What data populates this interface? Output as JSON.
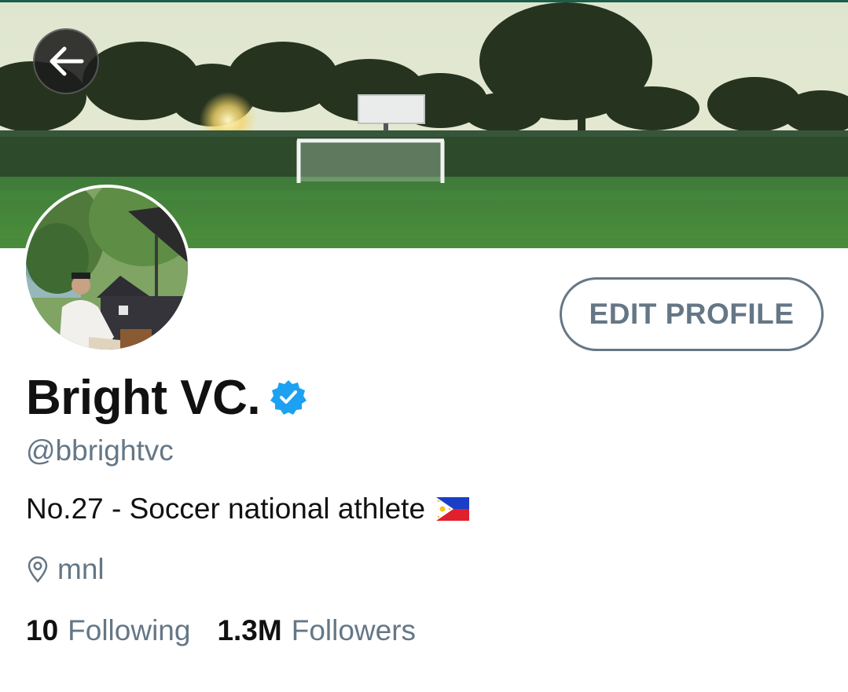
{
  "profile": {
    "display_name": "Bright VC.",
    "handle": "@bbrightvc",
    "bio": "No.27 - Soccer national athlete",
    "bio_emoji": "philippines-flag",
    "location": "mnl",
    "verified": true
  },
  "stats": {
    "following_count": "10",
    "following_label": "Following",
    "followers_count": "1.3M",
    "followers_label": "Followers"
  },
  "actions": {
    "edit_profile_label": "EDIT PROFILE"
  },
  "icons": {
    "back": "back-arrow-icon",
    "verified": "verified-badge-icon",
    "location": "location-pin-icon"
  },
  "colors": {
    "secondary_text": "#657786",
    "primary_text": "#111111",
    "verified_blue": "#1da1f2",
    "top_rule": "#1b5e4a"
  }
}
